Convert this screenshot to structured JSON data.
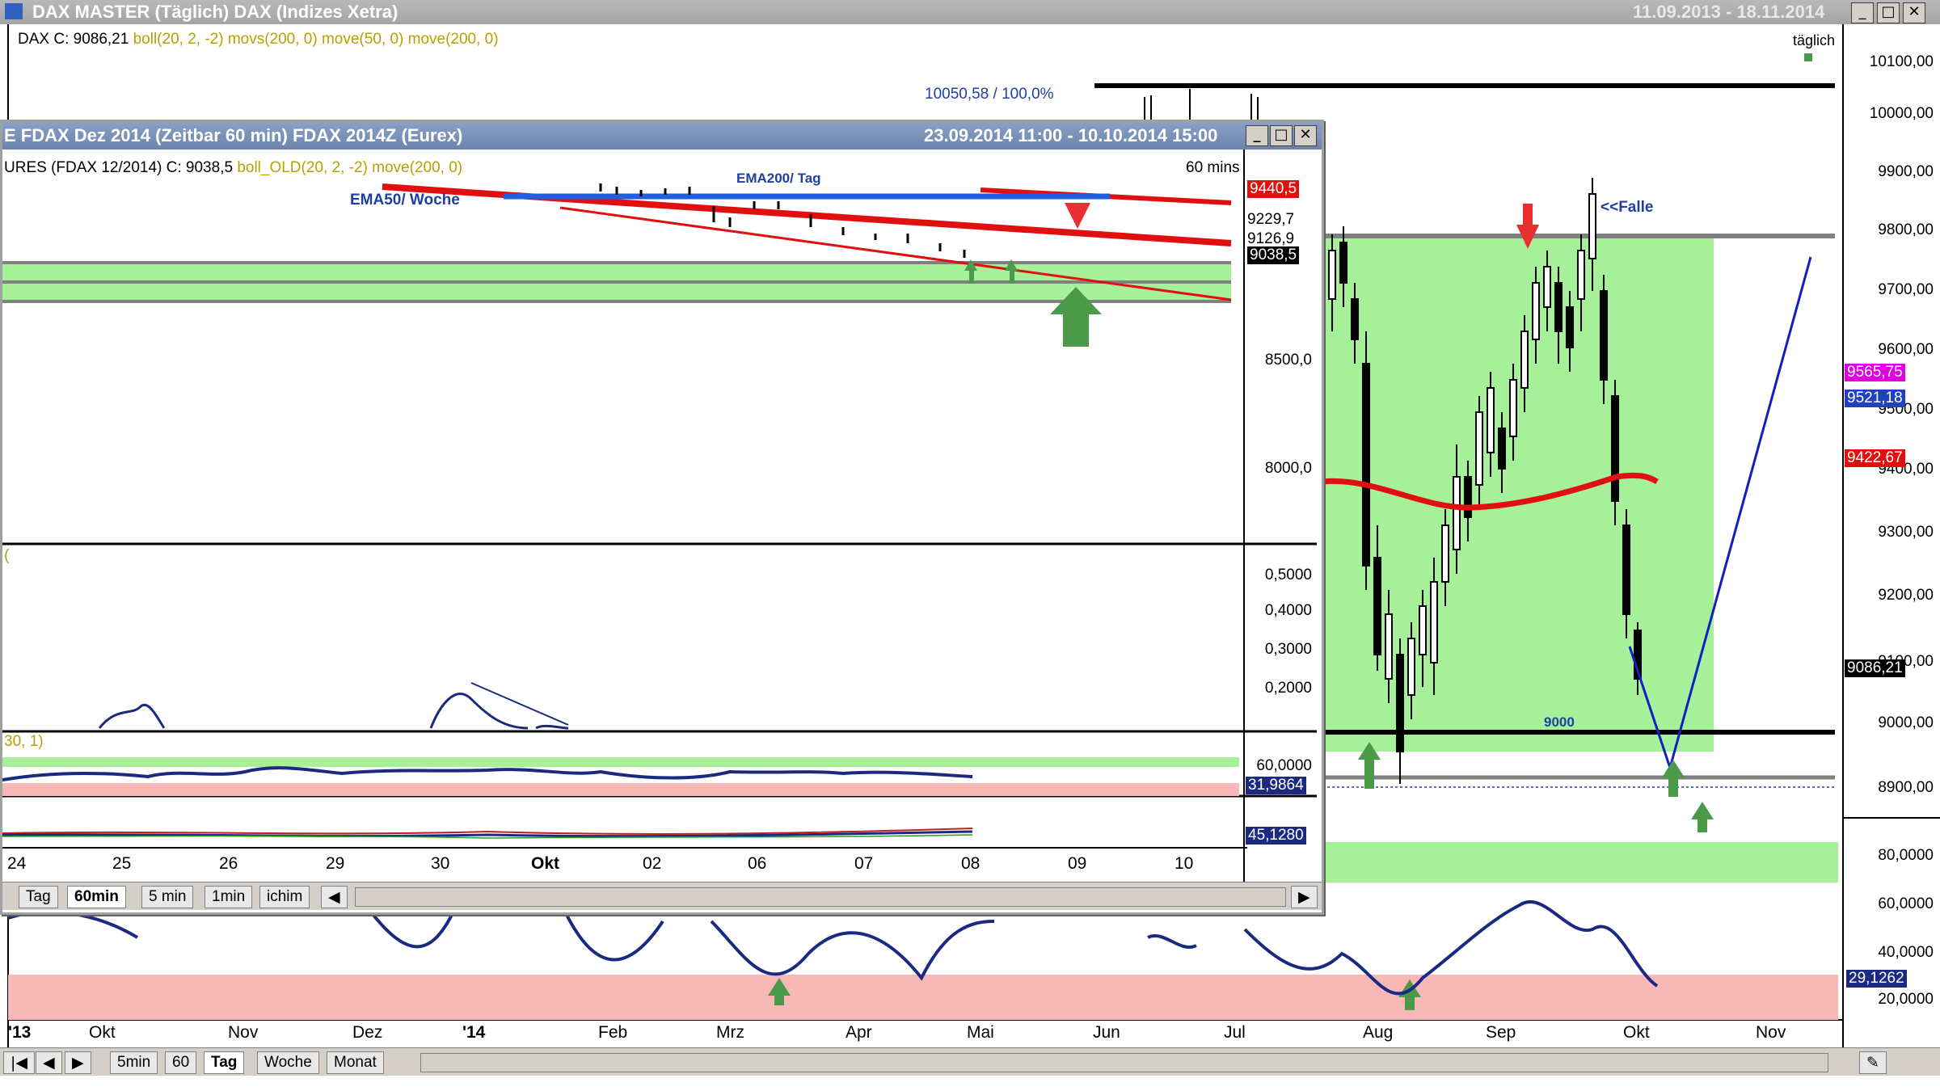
{
  "main_window": {
    "title": "DAX MASTER (Täglich)  DAX (Indizes Xetra)",
    "date_range": "11.09.2013 - 18.11.2014",
    "period_label": "täglich",
    "info_prefix": "DAX C: 9086,21",
    "info_indicators": "boll(20, 2, -2) movs(200, 0) move(50, 0) move(200, 0)",
    "fib_label": "10050,58 / 100,0%",
    "falle_label": "<<Falle",
    "level_9000_label": "9000",
    "price_axis": [
      "10100,00",
      "10000,00",
      "9900,00",
      "9800,00",
      "9700,00",
      "9600,00",
      "9500,00",
      "9400,00",
      "9300,00",
      "9200,00",
      "9100,00",
      "9000,00",
      "8900,00"
    ],
    "price_tags": [
      {
        "value": "9565,75",
        "color": "#e000e0"
      },
      {
        "value": "9521,18",
        "color": "#2040c0"
      },
      {
        "value": "9422,67",
        "color": "#e01010"
      },
      {
        "value": "9086,21",
        "color": "#000000"
      }
    ],
    "osc_axis": [
      "80,0000",
      "60,0000",
      "40,0000",
      "20,0000"
    ],
    "osc_tag": "29,1262",
    "x_labels": [
      "'13",
      "Okt",
      "Nov",
      "Dez",
      "'14",
      "Feb",
      "Mrz",
      "Apr",
      "Mai",
      "Jun",
      "Jul",
      "Aug",
      "Sep",
      "Okt",
      "Nov"
    ],
    "timeframe_tabs": [
      "5min",
      "60",
      "Tag",
      "Woche",
      "Monat"
    ],
    "selected_tab": "Tag"
  },
  "inner_window": {
    "title": "E FDAX Dez 2014 (Zeitbar 60 min)  FDAX 2014Z (Eurex)",
    "date_range": "23.09.2014 11:00 - 10.10.2014 15:00",
    "info": "URES (FDAX 12/2014) C: 9038,5",
    "info_indicators": "boll_OLD(20, 2, -2) move(200, 0)",
    "period": "60 mins",
    "ema_week": "EMA50/ Woche",
    "ema_day": "EMA200/ Tag",
    "price_axis": [
      "8500,0",
      "8000,0"
    ],
    "price_tags": [
      {
        "value": "9440,5",
        "color": "#e01010"
      },
      {
        "value": "9229,7",
        "color": "#ffffff"
      },
      {
        "value": "9126,9",
        "color": "#ffffff"
      },
      {
        "value": "9038,5",
        "color": "#000000"
      }
    ],
    "sub_axis": [
      "0,5000",
      "0,4000",
      "0,3000",
      "0,2000"
    ],
    "rsi_axis": "60,0000",
    "rsi_tag": "31,9864",
    "osc2_tag": "45,1280",
    "sub2_label": "30, 1)",
    "x_labels": [
      "24",
      "25",
      "26",
      "29",
      "30",
      "Okt",
      "02",
      "06",
      "07",
      "08",
      "09",
      "10"
    ],
    "timeframe_tabs": [
      "Tag",
      "60min",
      "5 min",
      "1min",
      "ichim"
    ],
    "selected_tab": "60min"
  },
  "colors": {
    "green_zone": "#a6f09a",
    "red_zone": "#f8b8b8",
    "osc_line": "#1a2a80",
    "ma_red": "#e01010",
    "trend_blue": "#1020c0",
    "arrow_green": "#4a9a4a",
    "arrow_red": "#e83030"
  }
}
